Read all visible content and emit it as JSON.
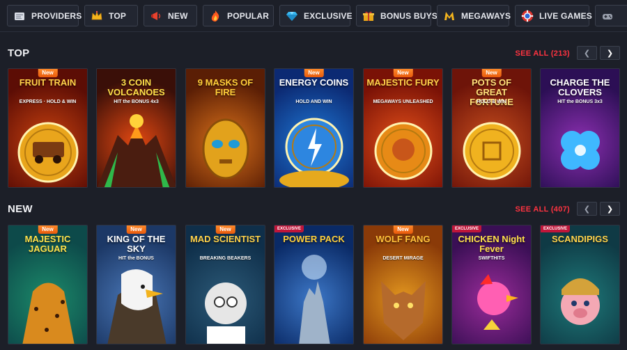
{
  "nav": [
    {
      "label": "PROVIDERS",
      "icon": "providers-icon"
    },
    {
      "label": "TOP",
      "icon": "crown-icon"
    },
    {
      "label": "NEW",
      "icon": "megaphone-icon"
    },
    {
      "label": "POPULAR",
      "icon": "fire-icon"
    },
    {
      "label": "EXCLUSIVE",
      "icon": "diamond-icon"
    },
    {
      "label": "BONUS BUYS",
      "icon": "gift-icon"
    },
    {
      "label": "MEGAWAYS",
      "icon": "megaways-icon"
    },
    {
      "label": "LIVE GAMES",
      "icon": "chip-icon"
    },
    {
      "label": "",
      "icon": "gamepad-icon"
    }
  ],
  "sections": [
    {
      "title": "TOP",
      "see_all": "SEE ALL (213)",
      "prev": "❮",
      "next": "❯",
      "games": [
        {
          "title": "FRUIT TRAIN",
          "subtitle": "EXPRESS · HOLD & WIN",
          "badge": "New",
          "colors": [
            "#5c0d05",
            "#c9420f"
          ]
        },
        {
          "title": "3 COIN VOLCANOES",
          "subtitle": "HIT the BONUS 4x3",
          "badge": "",
          "colors": [
            "#3a0f08",
            "#e24812"
          ]
        },
        {
          "title": "9 MASKS OF FIRE",
          "subtitle": "",
          "badge": "",
          "colors": [
            "#5a1e05",
            "#d9701a"
          ]
        },
        {
          "title": "ENERGY COINS",
          "subtitle": "HOLD AND WIN",
          "badge": "New",
          "colors": [
            "#0c2a73",
            "#1f78d6"
          ]
        },
        {
          "title": "MAJESTIC FURY",
          "subtitle": "MEGAWAYS UNLEASHED",
          "badge": "New",
          "colors": [
            "#7a1206",
            "#e4501a"
          ]
        },
        {
          "title": "POTS OF GREAT FORTUNE",
          "subtitle": "HOLD & WIN",
          "badge": "New",
          "colors": [
            "#6e1409",
            "#c94f1e"
          ]
        },
        {
          "title": "CHARGE THE CLOVERS",
          "subtitle": "HIT the BONUS 3x3",
          "badge": "",
          "colors": [
            "#2c0f55",
            "#8b2fb0"
          ]
        }
      ]
    },
    {
      "title": "NEW",
      "see_all": "SEE ALL (407)",
      "prev": "❮",
      "next": "❯",
      "games": [
        {
          "title": "MAJESTIC JAGUAR",
          "subtitle": "",
          "badge": "New",
          "colors": [
            "#0d4a4a",
            "#1c8a6a"
          ]
        },
        {
          "title": "KING OF THE SKY",
          "subtitle": "HIT the BONUS",
          "badge": "New",
          "colors": [
            "#1c3866",
            "#4a78b8"
          ]
        },
        {
          "title": "MAD SCIENTIST",
          "subtitle": "BREAKING BEAKERS",
          "badge": "New",
          "colors": [
            "#0f2f4a",
            "#2c5a78"
          ]
        },
        {
          "title": "POWER PACK",
          "subtitle": "",
          "badge": "EXCLUSIVE",
          "colors": [
            "#0a2a66",
            "#3d78c8"
          ]
        },
        {
          "title": "WOLF FANG",
          "subtitle": "DESERT MIRAGE",
          "badge": "New",
          "colors": [
            "#8a3a08",
            "#e2961f"
          ]
        },
        {
          "title": "CHICKEN Night Fever",
          "subtitle": "SWIFTHITS",
          "badge": "EXCLUSIVE",
          "colors": [
            "#3a0f55",
            "#9a2c9a"
          ]
        },
        {
          "title": "SCANDIPIGS",
          "subtitle": "",
          "badge": "EXCLUSIVE",
          "colors": [
            "#0f3a45",
            "#1e7a7a"
          ]
        }
      ]
    }
  ]
}
